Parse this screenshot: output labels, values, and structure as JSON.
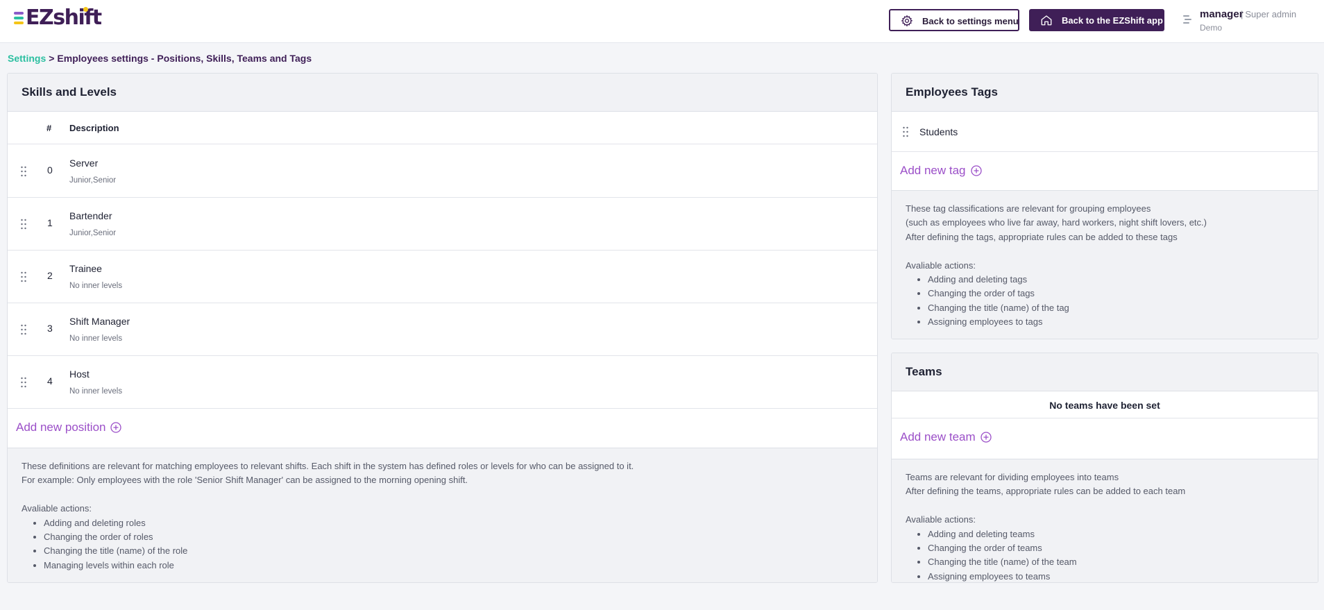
{
  "brand": {
    "logo_text": "EZshift",
    "colors": {
      "primary": "#3f1f57",
      "accent_purple": "#9b4fc8",
      "accent_green": "#2bbfa0",
      "logo_bar_1": "#8b5cc8",
      "logo_bar_2": "#2bbfa0",
      "logo_bar_3": "#f5c518"
    }
  },
  "header": {
    "settings_button_label": "Back to settings menu",
    "settings_button_icon": "gear-icon",
    "app_button_label": "Back to the EZShift app",
    "app_button_icon": "home-icon",
    "user": {
      "name": "manager",
      "separator": "|",
      "role": "Super admin",
      "org": "Demo"
    }
  },
  "breadcrumb": {
    "link": "Settings",
    "separator": ">",
    "current": "Employees settings - Positions, Skills, Teams and Tags"
  },
  "skills": {
    "title": "Skills and Levels",
    "columns": {
      "num": "#",
      "description": "Description"
    },
    "rows": [
      {
        "num": "0",
        "name": "Server",
        "levels": "Junior,Senior"
      },
      {
        "num": "1",
        "name": "Bartender",
        "levels": "Junior,Senior"
      },
      {
        "num": "2",
        "name": "Trainee",
        "levels": "No inner levels"
      },
      {
        "num": "3",
        "name": "Shift Manager",
        "levels": "No inner levels"
      },
      {
        "num": "4",
        "name": "Host",
        "levels": "No inner levels"
      }
    ],
    "add_label": "Add new position",
    "info": {
      "line1": "These definitions are relevant for matching employees to relevant shifts. Each shift in the system has defined roles or levels for who can be assigned to it.",
      "line2": "For example: Only employees with the role 'Senior Shift Manager' can be assigned to the morning opening shift.",
      "actions_title": "Avaliable actions:",
      "actions": [
        "Adding and deleting roles",
        "Changing the order of roles",
        "Changing the title (name) of the role",
        "Managing levels within each role"
      ]
    }
  },
  "tags": {
    "title": "Employees Tags",
    "items": [
      "Students"
    ],
    "add_label": "Add new tag",
    "info": {
      "line1": "These tag classifications are relevant for grouping employees",
      "line2": "(such as employees who live far away, hard workers, night shift lovers, etc.)",
      "line3": "After defining the tags, appropriate rules can be added to these tags",
      "actions_title": "Avaliable actions:",
      "actions": [
        "Adding and deleting tags",
        "Changing the order of tags",
        "Changing the title (name) of the tag",
        "Assigning employees to tags"
      ]
    }
  },
  "teams": {
    "title": "Teams",
    "empty_text": "No teams have been set",
    "add_label": "Add new team",
    "info": {
      "line1": "Teams are relevant for dividing employees into teams",
      "line2": "After defining the teams, appropriate rules can be added to each team",
      "actions_title": "Avaliable actions:",
      "actions": [
        "Adding and deleting teams",
        "Changing the order of teams",
        "Changing the title (name) of the team",
        "Assigning employees to teams"
      ]
    }
  }
}
